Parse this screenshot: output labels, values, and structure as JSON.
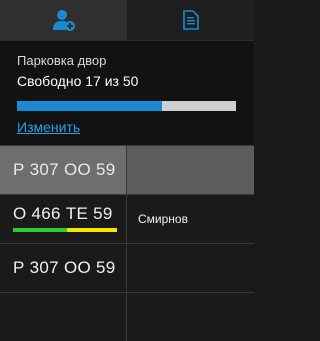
{
  "tabs": [
    {
      "name": "add-user",
      "icon": "add-user-icon",
      "active": true
    },
    {
      "name": "documents",
      "icon": "document-icon",
      "active": false
    }
  ],
  "parking": {
    "title": "Парковка двор",
    "status": "Свободно 17 из 50",
    "free": 17,
    "total": 50,
    "progress_fraction": 0.66,
    "change_label": "Изменить"
  },
  "rows": [
    {
      "plate": "Р 307 ОО 59",
      "name": "",
      "selected": true
    },
    {
      "plate": "О 466 ТЕ 59",
      "name": "Смирнов",
      "selected": false,
      "bar_colors": [
        "#2ecc2e",
        "#f5e400"
      ]
    },
    {
      "plate": "Р 307 ОО 59",
      "name": "",
      "selected": false
    },
    {
      "plate": "",
      "name": "",
      "selected": false
    }
  ],
  "colors": {
    "accent": "#1b8ad3",
    "link": "#2a9fe6",
    "progress_track": "#cfcfcf",
    "bar_green": "#2ecc2e",
    "bar_yellow": "#f5e400"
  }
}
